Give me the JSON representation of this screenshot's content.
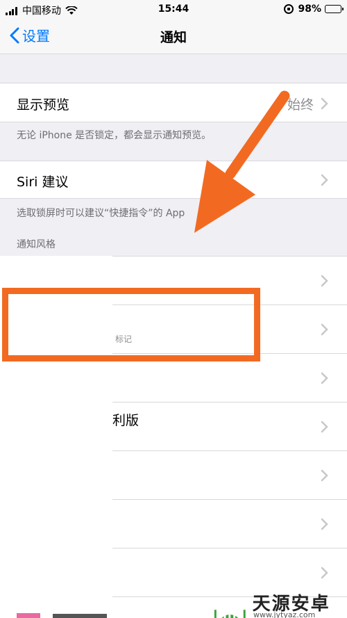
{
  "status_bar": {
    "carrier": "中国移动",
    "time": "15:44",
    "battery": "98%",
    "battery_level": 0.98
  },
  "nav": {
    "back_label": "设置",
    "title": "通知"
  },
  "preview": {
    "label": "显示预览",
    "value": "始终",
    "footnote": "无论 iPhone 是否锁定，都会显示通知预览。"
  },
  "siri": {
    "label": "Siri 建议",
    "footnote": "选取锁屏时可以建议“快捷指令”的 App"
  },
  "style_section": {
    "header": "通知风格",
    "rows": [
      {
        "text": ""
      },
      {
        "text": "",
        "subtext": "标记"
      },
      {
        "text": ""
      },
      {
        "text": "利版"
      },
      {
        "text": ""
      },
      {
        "text": ""
      },
      {
        "text": ""
      }
    ]
  },
  "watermark": {
    "title": "天源安卓网",
    "url": "www.jytyaz.com"
  },
  "colors": {
    "accent": "#007aff",
    "annotation": "#f26a21",
    "watermark_green": "#3aa33a"
  }
}
